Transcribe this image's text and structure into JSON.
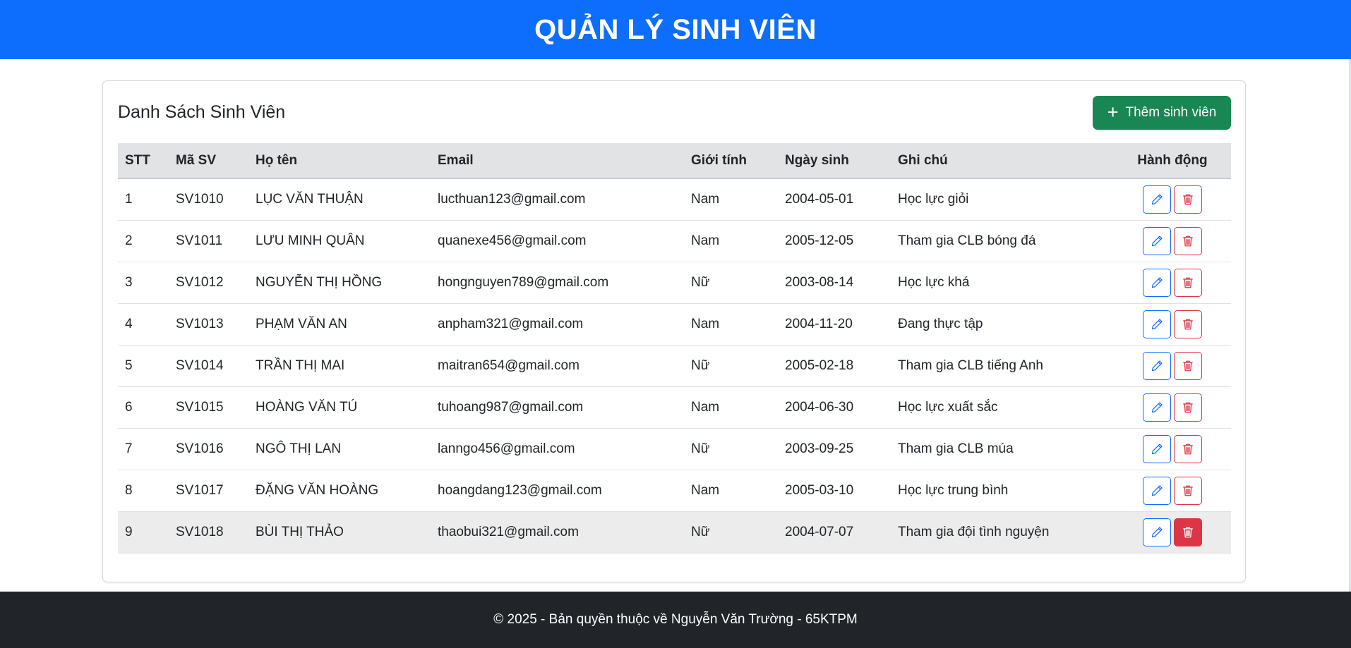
{
  "header": {
    "title": "QUẢN LÝ SINH VIÊN"
  },
  "panel": {
    "title": "Danh Sách Sinh Viên",
    "add_button": {
      "icon": "plus-icon",
      "label": "Thêm sinh viên"
    }
  },
  "table": {
    "columns": [
      "STT",
      "Mã SV",
      "Họ tên",
      "Email",
      "Giới tính",
      "Ngày sinh",
      "Ghi chú",
      "Hành động"
    ],
    "rows": [
      {
        "stt": "1",
        "id": "SV1010",
        "name": "LỤC VĂN THUẬN",
        "email": "lucthuan123@gmail.com",
        "gender": "Nam",
        "dob": "2004-05-01",
        "note": "Học lực giỏi"
      },
      {
        "stt": "2",
        "id": "SV1011",
        "name": "LƯU MINH QUÂN",
        "email": "quanexe456@gmail.com",
        "gender": "Nam",
        "dob": "2005-12-05",
        "note": "Tham gia CLB bóng đá"
      },
      {
        "stt": "3",
        "id": "SV1012",
        "name": "NGUYỄN THỊ HỒNG",
        "email": "hongnguyen789@gmail.com",
        "gender": "Nữ",
        "dob": "2003-08-14",
        "note": "Học lực khá"
      },
      {
        "stt": "4",
        "id": "SV1013",
        "name": "PHẠM VĂN AN",
        "email": "anpham321@gmail.com",
        "gender": "Nam",
        "dob": "2004-11-20",
        "note": "Đang thực tập"
      },
      {
        "stt": "5",
        "id": "SV1014",
        "name": "TRẦN THỊ MAI",
        "email": "maitran654@gmail.com",
        "gender": "Nữ",
        "dob": "2005-02-18",
        "note": "Tham gia CLB tiếng Anh"
      },
      {
        "stt": "6",
        "id": "SV1015",
        "name": "HOÀNG VĂN TÚ",
        "email": "tuhoang987@gmail.com",
        "gender": "Nam",
        "dob": "2004-06-30",
        "note": "Học lực xuất sắc"
      },
      {
        "stt": "7",
        "id": "SV1016",
        "name": "NGÔ THỊ LAN",
        "email": "lanngo456@gmail.com",
        "gender": "Nữ",
        "dob": "2003-09-25",
        "note": "Tham gia CLB múa"
      },
      {
        "stt": "8",
        "id": "SV1017",
        "name": "ĐẶNG VĂN HOÀNG",
        "email": "hoangdang123@gmail.com",
        "gender": "Nam",
        "dob": "2005-03-10",
        "note": "Học lực trung bình"
      },
      {
        "stt": "9",
        "id": "SV1018",
        "name": "BÙI THỊ THẢO",
        "email": "thaobui321@gmail.com",
        "gender": "Nữ",
        "dob": "2004-07-07",
        "note": "Tham gia đội tình nguyện"
      }
    ],
    "row_actions": {
      "edit_icon": "pencil-icon",
      "delete_icon": "trash-icon"
    }
  },
  "footer": {
    "text": "© 2025 - Bản quyền thuộc về Nguyễn Văn Trường - 65KTPM"
  },
  "colors": {
    "primary": "#0d6efd",
    "success": "#198754",
    "danger": "#dc3545",
    "footer_bg": "#212529",
    "table_header_bg": "#e2e3e5"
  }
}
